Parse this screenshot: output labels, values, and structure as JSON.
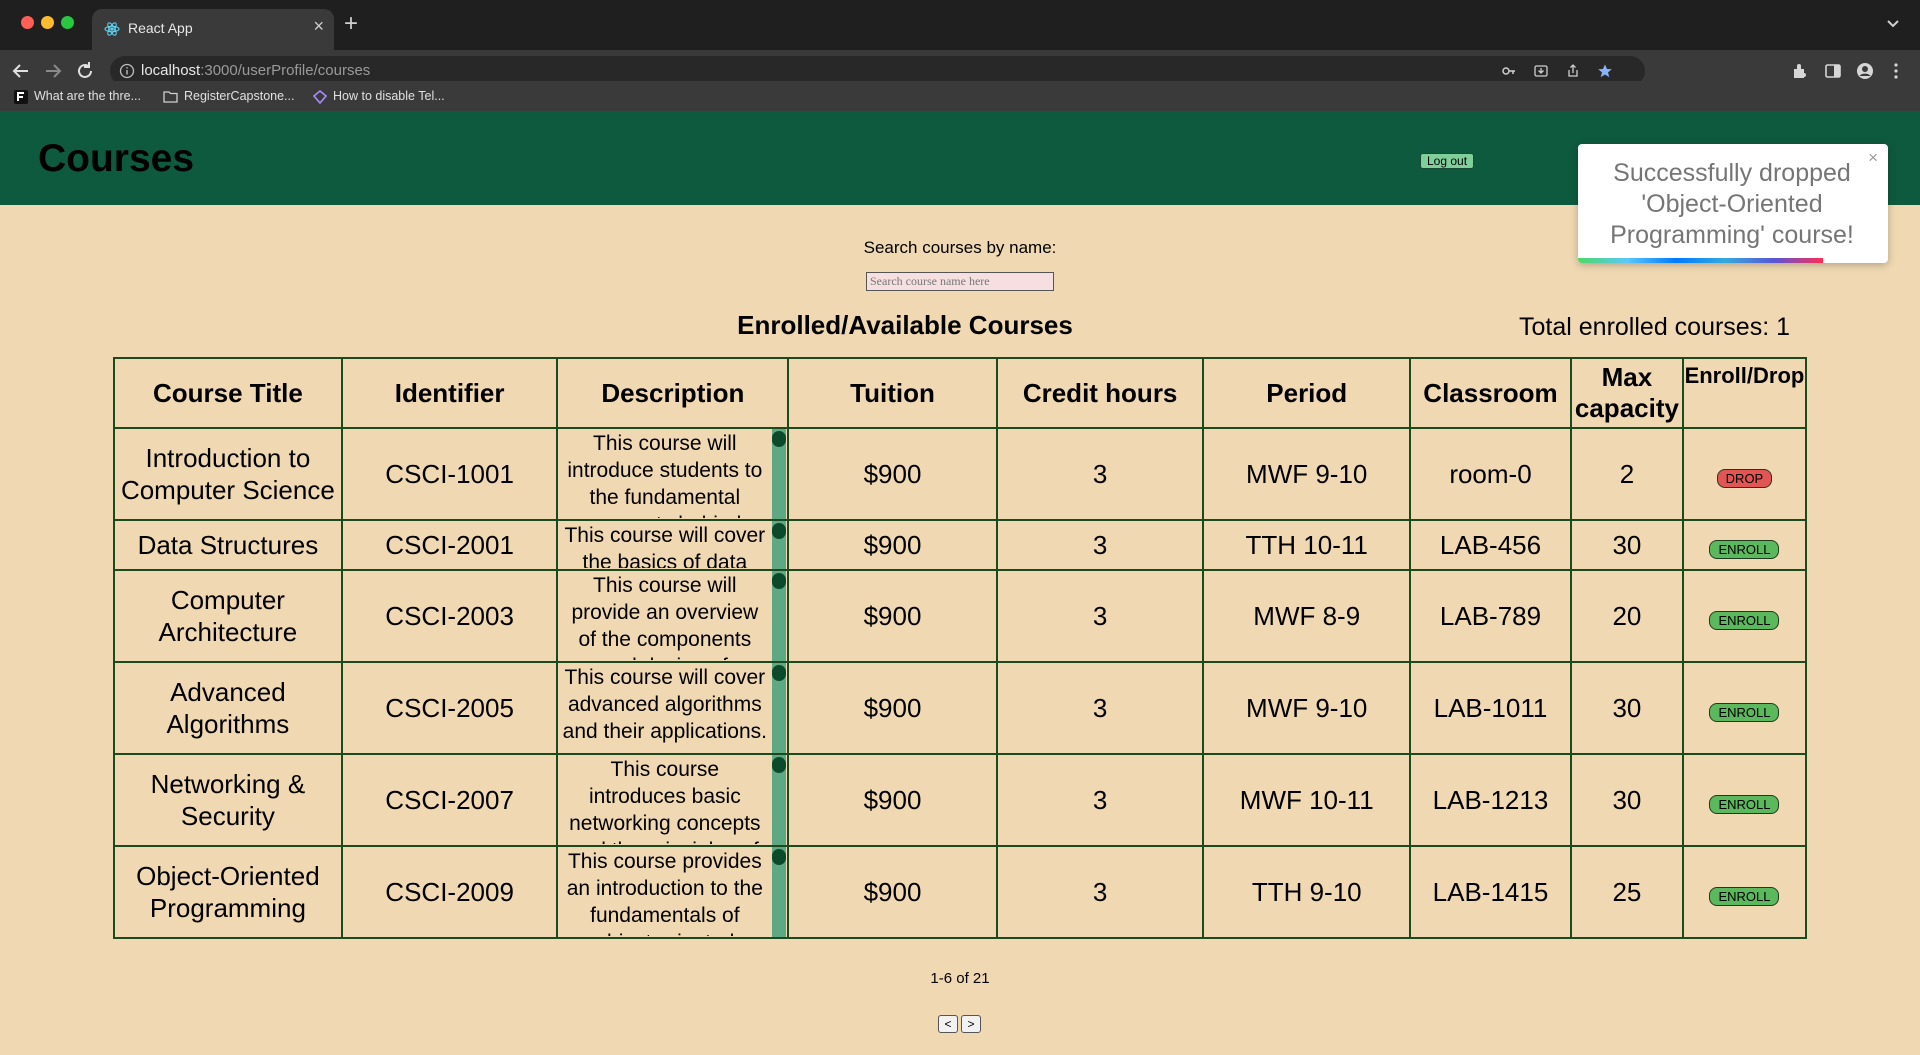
{
  "browser": {
    "tab_title": "React App",
    "url_host": "localhost",
    "url_rest": ":3000/userProfile/courses",
    "bookmarks": [
      {
        "label": "What are the thre...",
        "icon": "f-logo-icon"
      },
      {
        "label": "RegisterCapstone...",
        "icon": "folder-icon"
      },
      {
        "label": "How to disable Tel...",
        "icon": "diamond-icon"
      }
    ]
  },
  "header": {
    "title": "Courses",
    "logout_label": "Log out"
  },
  "toast": {
    "message": "Successfully dropped 'Object-Oriented Programming' course!",
    "close": "×"
  },
  "search": {
    "label": "Search courses by name:",
    "placeholder": "Search course name here",
    "value": ""
  },
  "table": {
    "title": "Enrolled/Available Courses",
    "total_enrolled": "Total enrolled courses: 1",
    "columns": [
      "Course Title",
      "Identifier",
      "Description",
      "Tuition",
      "Credit hours",
      "Period",
      "Classroom",
      "Max capacity",
      "Enroll/Drop"
    ],
    "rows": [
      {
        "title": "Introduction to Computer Science",
        "id": "CSCI-1001",
        "description": "This course will introduce students to the fundamental concepts behind computer science.",
        "tuition": "$900",
        "credits": "3",
        "period": "MWF 9-10",
        "room": "room-0",
        "capacity": "2",
        "action": "DROP"
      },
      {
        "title": "Data Structures",
        "id": "CSCI-2001",
        "description": "This course will cover the basics of data structures and algorithms.",
        "tuition": "$900",
        "credits": "3",
        "period": "TTH 10-11",
        "room": "LAB-456",
        "capacity": "30",
        "action": "ENROLL"
      },
      {
        "title": "Computer Architecture",
        "id": "CSCI-2003",
        "description": "This course will provide an overview of the components and design of computer systems.",
        "tuition": "$900",
        "credits": "3",
        "period": "MWF 8-9",
        "room": "LAB-789",
        "capacity": "20",
        "action": "ENROLL"
      },
      {
        "title": "Advanced Algorithms",
        "id": "CSCI-2005",
        "description": "This course will cover advanced algorithms and their applications.",
        "tuition": "$900",
        "credits": "3",
        "period": "MWF 9-10",
        "room": "LAB-1011",
        "capacity": "30",
        "action": "ENROLL"
      },
      {
        "title": "Networking & Security",
        "id": "CSCI-2007",
        "description": "This course introduces basic networking concepts and the principles of security.",
        "tuition": "$900",
        "credits": "3",
        "period": "MWF 10-11",
        "room": "LAB-1213",
        "capacity": "30",
        "action": "ENROLL"
      },
      {
        "title": "Object-Oriented Programming",
        "id": "CSCI-2009",
        "description": "This course provides an introduction to the fundamentals of object-oriented programming.",
        "tuition": "$900",
        "credits": "3",
        "period": "TTH 9-10",
        "room": "LAB-1415",
        "capacity": "25",
        "action": "ENROLL"
      }
    ]
  },
  "pagination": {
    "text": "1-6 of 21",
    "prev_label": "<",
    "next_label": ">"
  }
}
